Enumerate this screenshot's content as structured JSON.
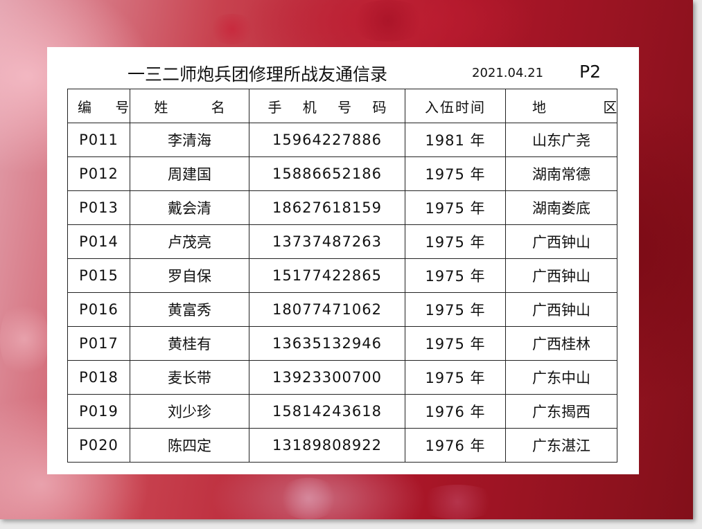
{
  "header": {
    "title": "一三二师炮兵团修理所战友通信录",
    "date": "2021.04.21",
    "page": "P2"
  },
  "table": {
    "columns": [
      "编 号",
      "姓 名",
      "手 机 号 码",
      "入伍时间",
      "地 区"
    ],
    "rows": [
      {
        "id": "P011",
        "name": "李清海",
        "phone": "15964227886",
        "year": "1981 年",
        "region": "山东广尧"
      },
      {
        "id": "P012",
        "name": "周建国",
        "phone": "15886652186",
        "year": "1975 年",
        "region": "湖南常德"
      },
      {
        "id": "P013",
        "name": "戴会清",
        "phone": "18627618159",
        "year": "1975 年",
        "region": "湖南娄底"
      },
      {
        "id": "P014",
        "name": "卢茂亮",
        "phone": "13737487263",
        "year": "1975 年",
        "region": "广西钟山"
      },
      {
        "id": "P015",
        "name": "罗自保",
        "phone": "15177422865",
        "year": "1975 年",
        "region": "广西钟山"
      },
      {
        "id": "P016",
        "name": "黄富秀",
        "phone": "18077471062",
        "year": "1975 年",
        "region": "广西钟山"
      },
      {
        "id": "P017",
        "name": "黄桂有",
        "phone": "13635132946",
        "year": "1975 年",
        "region": "广西桂林"
      },
      {
        "id": "P018",
        "name": "麦长带",
        "phone": "13923300700",
        "year": "1975 年",
        "region": "广东中山"
      },
      {
        "id": "P019",
        "name": "刘少珍",
        "phone": "15814243618",
        "year": "1976 年",
        "region": "广东揭西"
      },
      {
        "id": "P020",
        "name": "陈四定",
        "phone": "13189808922",
        "year": "1976 年",
        "region": "广东湛江"
      }
    ]
  },
  "theme": {
    "background_primary": "#b0172a",
    "background_light": "#e2a2ae",
    "panel": "#ffffff",
    "text": "#111111"
  }
}
